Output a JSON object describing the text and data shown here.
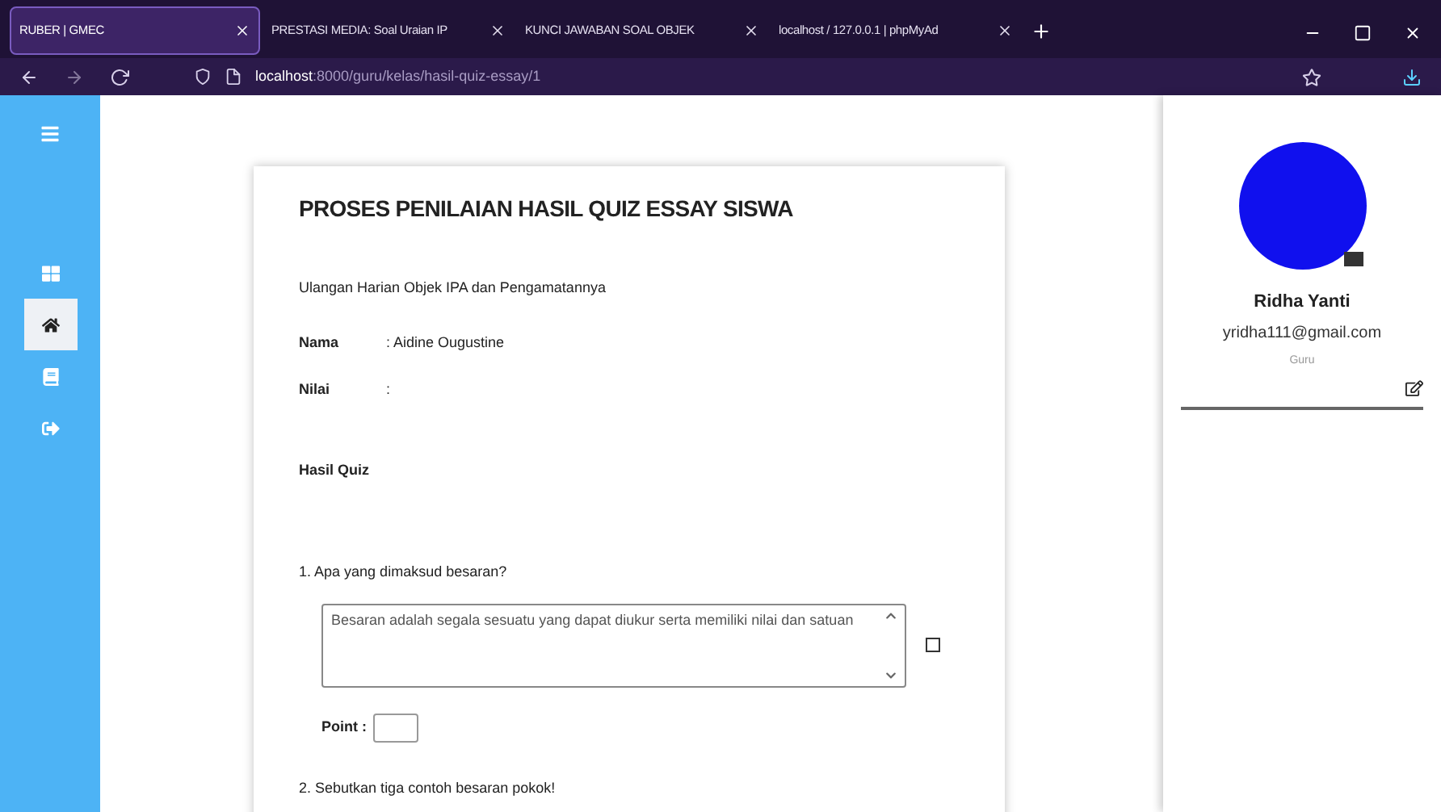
{
  "browser": {
    "tabs": [
      {
        "label": "RUBER | GMEC",
        "selected": true
      },
      {
        "label": "PRESTASI MEDIA: Soal Uraian IP",
        "selected": false
      },
      {
        "label": "KUNCI JAWABAN SOAL OBJEK",
        "selected": false
      },
      {
        "label": "localhost / 127.0.0.1 | phpMyAd",
        "selected": false
      }
    ],
    "url_host": "localhost",
    "url_path": ":8000/guru/kelas/hasil-quiz-essay/1"
  },
  "sidebar": {
    "items": [
      {
        "kind": "grid",
        "selected": false
      },
      {
        "kind": "home",
        "selected": true
      },
      {
        "kind": "book",
        "selected": false
      },
      {
        "kind": "logout",
        "selected": false
      }
    ]
  },
  "card": {
    "title": "PROSES PENILAIAN HASIL QUIZ ESSAY SISWA",
    "subtitle": "Ulangan Harian Objek IPA dan Pengamatannya",
    "fields": [
      {
        "label": "Nama",
        "value": ": Aidine Ougustine"
      },
      {
        "label": "Nilai",
        "value": ":"
      }
    ],
    "section": "Hasil Quiz",
    "questions": [
      {
        "number": "1.",
        "text": "Apa yang dimaksud besaran?",
        "answer": "Besaran adalah segala sesuatu yang dapat diukur serta memiliki nilai dan satuan",
        "checked": false,
        "point_label": "Point :"
      },
      {
        "number": "2.",
        "text": "Sebutkan tiga contoh besaran pokok!"
      }
    ]
  },
  "profile": {
    "name": "Ridha Yanti",
    "email": "yridha111@gmail.com",
    "role": "Guru"
  }
}
